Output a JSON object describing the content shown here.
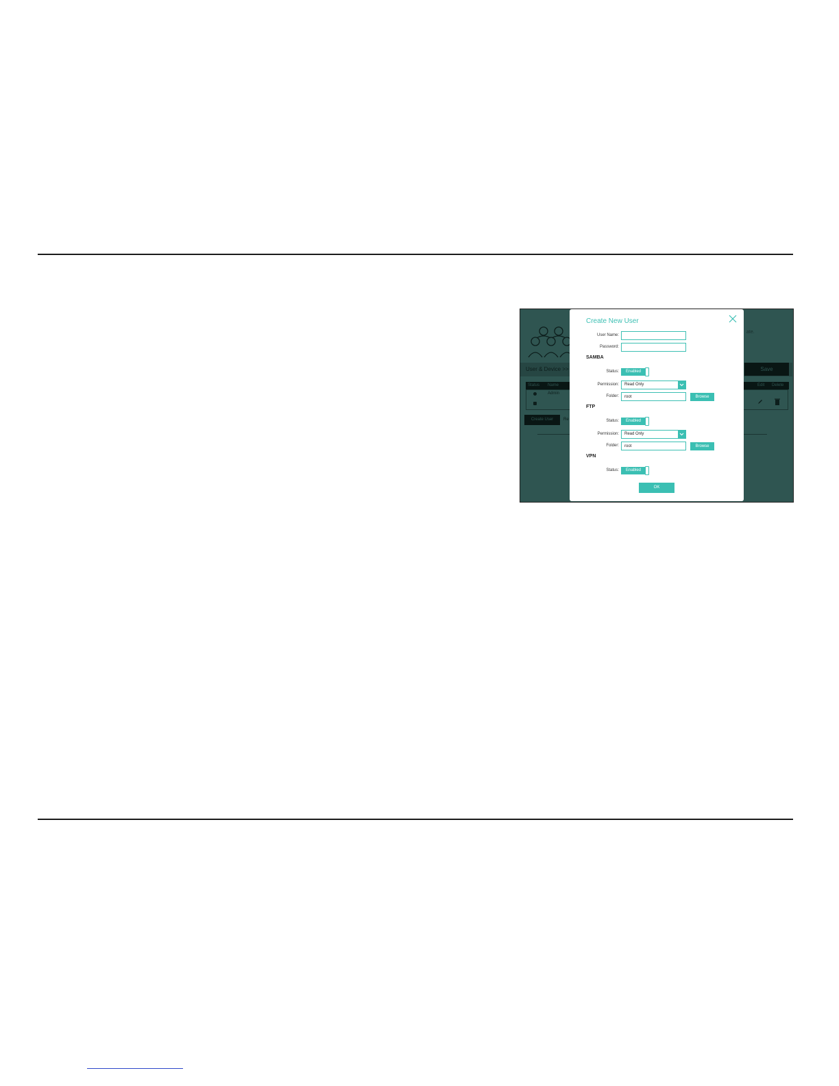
{
  "background": {
    "breadcrumb": "User & Device >>",
    "save_label": "Save",
    "header_stub": "ate.",
    "table": {
      "headers": [
        "Status",
        "Name",
        "Edit",
        "Delete"
      ],
      "rows": [
        {
          "name": "Admin"
        }
      ]
    },
    "create_user_label": "Create User",
    "stub_text": "Re"
  },
  "modal": {
    "title": "Create New User",
    "user_name_label": "User Name:",
    "user_name_value": "",
    "password_label": "Password:",
    "password_value": "",
    "samba": {
      "heading": "SAMBA",
      "status_label": "Status:",
      "status_value": "Enabled",
      "permission_label": "Permission:",
      "permission_value": "Read Only",
      "folder_label": "Folder:",
      "folder_value": "root",
      "browse_label": "Browse"
    },
    "ftp": {
      "heading": "FTP",
      "status_label": "Status:",
      "status_value": "Enabled",
      "permission_label": "Permission:",
      "permission_value": "Read Only",
      "folder_label": "Folder:",
      "folder_value": "root",
      "browse_label": "Browse"
    },
    "vpn": {
      "heading": "VPN",
      "status_label": "Status:",
      "status_value": "Enabled"
    },
    "ok_label": "OK"
  },
  "colors": {
    "accent": "#3bbfb3",
    "overlay": "#2f5551",
    "rule": "#1a1a1a"
  }
}
